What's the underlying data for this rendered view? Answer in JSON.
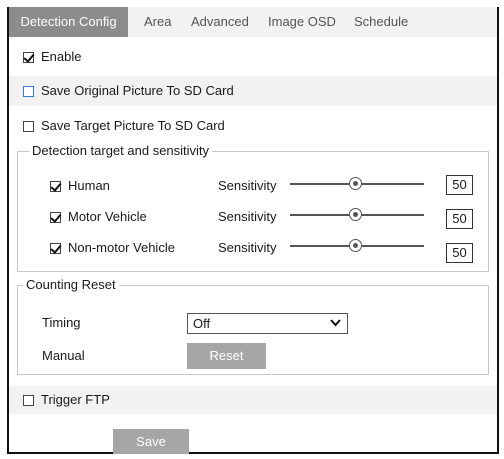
{
  "tabs": [
    {
      "label": "Detection Config",
      "active": true
    },
    {
      "label": "Area",
      "active": false
    },
    {
      "label": "Advanced",
      "active": false
    },
    {
      "label": "Image OSD",
      "active": false
    },
    {
      "label": "Schedule",
      "active": false
    }
  ],
  "enable": {
    "label": "Enable",
    "checked": true
  },
  "save_original": {
    "label": "Save Original Picture To SD Card",
    "checked": false
  },
  "save_target": {
    "label": "Save Target Picture To SD Card",
    "checked": false
  },
  "detection": {
    "legend": "Detection target and sensitivity",
    "sensitivity_label": "Sensitivity",
    "targets": [
      {
        "label": "Human",
        "checked": true,
        "value": "50"
      },
      {
        "label": "Motor Vehicle",
        "checked": true,
        "value": "50"
      },
      {
        "label": "Non-motor Vehicle",
        "checked": true,
        "value": "50"
      }
    ]
  },
  "counting": {
    "legend": "Counting Reset",
    "timing_label": "Timing",
    "timing_value": "Off",
    "manual_label": "Manual",
    "reset_label": "Reset"
  },
  "trigger_ftp": {
    "label": "Trigger FTP",
    "checked": false
  },
  "save_label": "Save",
  "colors": {
    "active_tab": "#8c8c8c",
    "shaded": "#f2f2f2",
    "button": "#a6a6a6"
  }
}
